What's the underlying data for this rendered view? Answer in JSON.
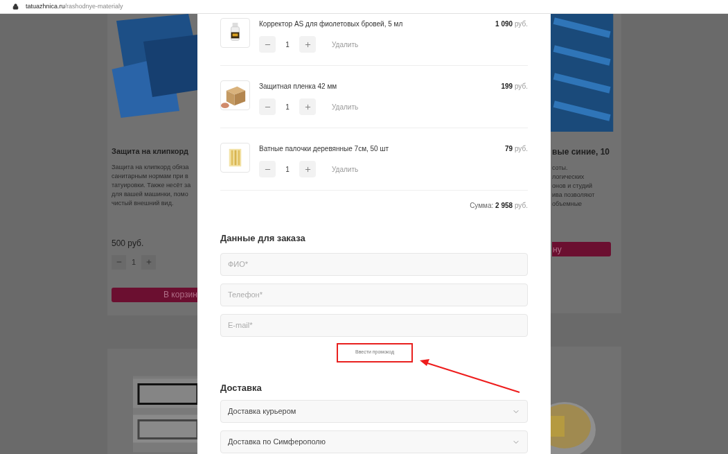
{
  "address_bar": {
    "domain": "tatuazhnica.ru",
    "path": "/rashodnye-materialy"
  },
  "background_cards": [
    {
      "title": "Защита на клипкорд",
      "description_lines": [
        "Защита на клипкорд обяза",
        "санитарным нормам при в",
        "татуировки. Также несёт за",
        "для вашей машинки, помо",
        "чистый внешний вид."
      ],
      "price": "500 руб.",
      "quantity": "1",
      "button": "В корзин"
    },
    {
      "title": "вые синие, 10",
      "description_lines": [
        "соты.",
        "логических",
        "онов и студий",
        "ива позволяют",
        "объемные"
      ],
      "button": "ну"
    }
  ],
  "cart": {
    "items": [
      {
        "kind": "bottle",
        "name": "Корректор AS для фиолетовых бровей, 5 мл",
        "price": "1 090",
        "currency": "руб.",
        "quantity": "1",
        "remove": "Удалить"
      },
      {
        "kind": "box",
        "name": "Защитная пленка 42 мм",
        "price": "199",
        "currency": "руб.",
        "quantity": "1",
        "remove": "Удалить"
      },
      {
        "kind": "sticks",
        "name": "Ватные палочки деревянные 7см, 50 шт",
        "price": "79",
        "currency": "руб.",
        "quantity": "1",
        "remove": "Удалить"
      }
    ],
    "sum_label": "Сумма:",
    "sum_value": "2 958",
    "sum_currency": "руб."
  },
  "order_form": {
    "title": "Данные для заказа",
    "fields": [
      {
        "placeholder": "ФИО*"
      },
      {
        "placeholder": "Телефон*"
      },
      {
        "placeholder": "E-mail*"
      }
    ],
    "promo_link": "Ввести промокод"
  },
  "delivery": {
    "title": "Доставка",
    "selects": [
      {
        "value": "Доставка курьером"
      },
      {
        "value": "Доставка по Симферополю"
      }
    ]
  }
}
